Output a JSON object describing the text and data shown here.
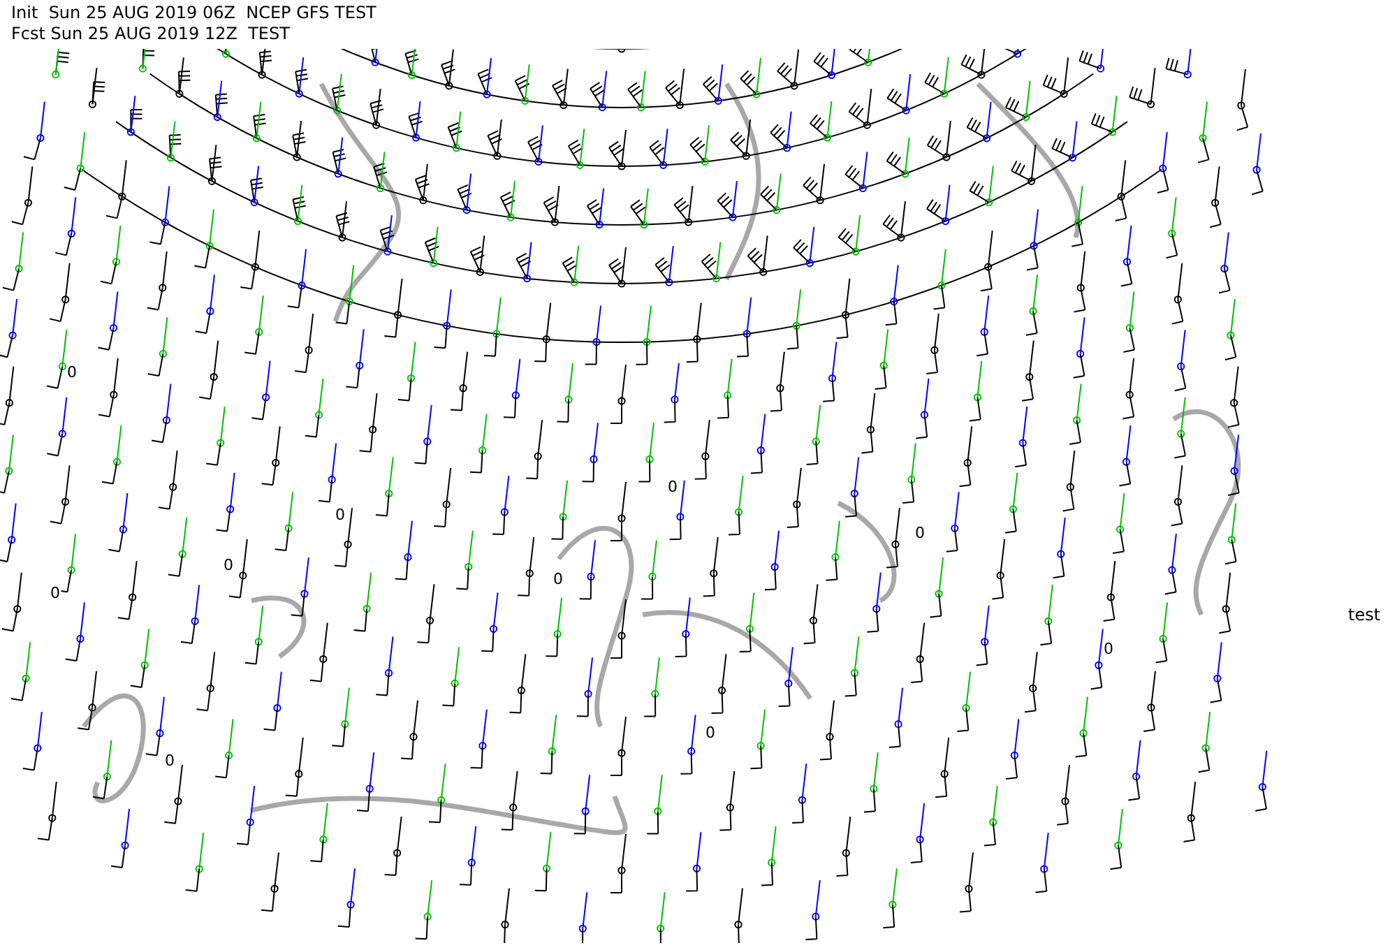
{
  "header": {
    "init_line": "Init  Sun 25 AUG 2019 06Z  NCEP GFS TEST",
    "fcst_line": "Fcst Sun 25 AUG 2019 12Z  TEST"
  },
  "side_label": "test",
  "contour_labels": [
    "0",
    "0",
    "0",
    "0",
    "0",
    "0",
    "0",
    "0",
    "0",
    "0"
  ]
}
